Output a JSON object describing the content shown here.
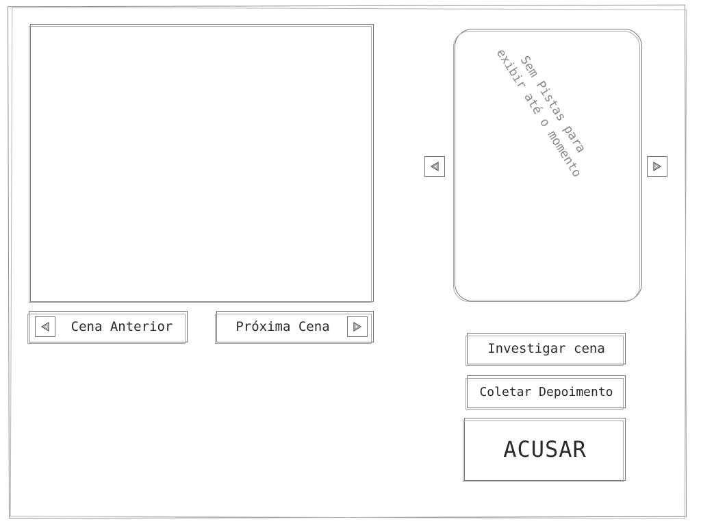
{
  "scene": {
    "prev_label": "Cena Anterior",
    "next_label": "Próxima Cena"
  },
  "clues": {
    "empty_message": "Sem Pistas para\nexibir até o momento"
  },
  "actions": {
    "investigate_label": "Investigar cena",
    "collect_label": "Coletar Depoimento",
    "accuse_label": "ACUSAR"
  },
  "icons": {
    "prev_scene": "triangle-left-icon",
    "next_scene": "triangle-right-icon",
    "clue_prev": "triangle-left-icon",
    "clue_next": "triangle-right-icon"
  }
}
